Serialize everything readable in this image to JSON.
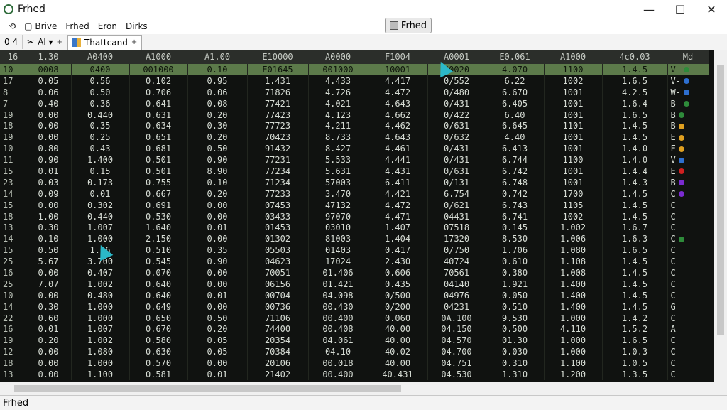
{
  "window": {
    "title": "Frhed",
    "minimize": "—",
    "maximize": "☐",
    "close": "✕"
  },
  "menu": {
    "items": [
      "Brive",
      "Frhed",
      "Eron",
      "Dirks"
    ]
  },
  "app_button": {
    "label": "Frhed"
  },
  "tabs": [
    {
      "label": "0 4"
    },
    {
      "label": "Al ▾",
      "close": "+"
    },
    {
      "label": "Thattcand",
      "close": "+"
    }
  ],
  "table": {
    "headers": [
      "16",
      "1.30",
      "A0400",
      "A1000",
      "A1.00",
      "E10000",
      "A0000",
      "F1004",
      "A0001",
      "E0.061",
      "A1000",
      "4c0.03",
      "Md"
    ],
    "rows": [
      [
        "10",
        "0008",
        "0400",
        "001000",
        "0.10",
        "E01645",
        "001000",
        "10001",
        "50020",
        "4.070",
        "1100",
        "1.4.5",
        "V-"
      ],
      [
        "17",
        "0.05",
        "0.56",
        "0.102",
        "0.95",
        "1.431",
        "4.433",
        "4.417",
        "0/552",
        "6.22",
        "1002",
        "1.6.5",
        "V-"
      ],
      [
        "8",
        "0.06",
        "0.50",
        "0.706",
        "0.06",
        "71826",
        "4.726",
        "4.472",
        "0/480",
        "6.670",
        "1001",
        "4.2.5",
        "W-"
      ],
      [
        "7",
        "0.40",
        "0.36",
        "0.641",
        "0.08",
        "77421",
        "4.021",
        "4.643",
        "0/431",
        "6.405",
        "1001",
        "1.6.4",
        "B-"
      ],
      [
        "19",
        "0.00",
        "0.440",
        "0.631",
        "0.20",
        "77423",
        "4.123",
        "4.662",
        "0/422",
        "6.40",
        "1001",
        "1.6.5",
        "B"
      ],
      [
        "18",
        "0.00",
        "0.35",
        "0.634",
        "0.30",
        "77723",
        "4.211",
        "4.462",
        "0/631",
        "6.645",
        "1101",
        "1.4.5",
        "B"
      ],
      [
        "19",
        "0.00",
        "0.25",
        "0.651",
        "0.20",
        "70423",
        "8.733",
        "4.643",
        "0/632",
        "4.40",
        "1001",
        "1.4.5",
        "E"
      ],
      [
        "10",
        "0.80",
        "0.43",
        "0.681",
        "0.50",
        "91432",
        "8.427",
        "4.461",
        "0/431",
        "6.413",
        "1001",
        "1.4.0",
        "F"
      ],
      [
        "11",
        "0.90",
        "1.400",
        "0.501",
        "0.90",
        "77231",
        "5.533",
        "4.441",
        "0/431",
        "6.744",
        "1100",
        "1.4.0",
        "V"
      ],
      [
        "15",
        "0.01",
        "0.15",
        "0.501",
        "8.90",
        "77234",
        "5.631",
        "4.431",
        "0/631",
        "6.742",
        "1001",
        "1.4.4",
        "E"
      ],
      [
        "23",
        "0.03",
        "0.173",
        "0.755",
        "0.10",
        "71234",
        "57003",
        "6.411",
        "0/131",
        "6.748",
        "1001",
        "1.4.3",
        "B"
      ],
      [
        "14",
        "0.09",
        "0.01",
        "0.667",
        "0.20",
        "77233",
        "3.470",
        "4.421",
        "6.754",
        "0.742",
        "1700",
        "1.4.5",
        "C"
      ],
      [
        "15",
        "0.00",
        "0.302",
        "0.691",
        "0.00",
        "07453",
        "47132",
        "4.472",
        "0/621",
        "6.743",
        "1105",
        "1.4.5",
        "C"
      ],
      [
        "18",
        "1.00",
        "0.440",
        "0.530",
        "0.00",
        "03433",
        "97070",
        "4.471",
        "04431",
        "6.741",
        "1002",
        "1.4.5",
        "C"
      ],
      [
        "13",
        "0.30",
        "1.007",
        "1.640",
        "0.01",
        "01453",
        "03010",
        "1.407",
        "07518",
        "0.145",
        "1.002",
        "1.6.7",
        "C"
      ],
      [
        "14",
        "0.10",
        "1.000",
        "2.150",
        "0.00",
        "01302",
        "81003",
        "1.404",
        "17320",
        "8.530",
        "1.006",
        "1.6.3",
        "C"
      ],
      [
        "15",
        "0.50",
        "1.06",
        "0.510",
        "0.35",
        "05503",
        "01403",
        "0.417",
        "0/750",
        "1.706",
        "1.080",
        "1.6.5",
        "C"
      ],
      [
        "25",
        "5.67",
        "3.700",
        "0.545",
        "0.90",
        "04623",
        "17024",
        "2.430",
        "40724",
        "0.610",
        "1.108",
        "1.4.5",
        "C"
      ],
      [
        "16",
        "0.00",
        "0.407",
        "0.070",
        "0.00",
        "70051",
        "01.406",
        "0.606",
        "70561",
        "0.380",
        "1.008",
        "1.4.5",
        "C"
      ],
      [
        "25",
        "7.07",
        "1.002",
        "0.640",
        "0.00",
        "06156",
        "01.421",
        "0.435",
        "04140",
        "1.921",
        "1.400",
        "1.4.5",
        "C"
      ],
      [
        "10",
        "0.00",
        "0.480",
        "0.640",
        "0.01",
        "00704",
        "04.098",
        "0/500",
        "04976",
        "0.050",
        "1.400",
        "1.4.5",
        "C"
      ],
      [
        "14",
        "0.30",
        "1.000",
        "0.649",
        "0.00",
        "00736",
        "00.430",
        "0/200",
        "04231",
        "0.510",
        "1.400",
        "1.4.5",
        "G"
      ],
      [
        "22",
        "0.60",
        "1.000",
        "0.650",
        "0.50",
        "71106",
        "00.400",
        "0.060",
        "0A.100",
        "9.530",
        "1.000",
        "1.4.2",
        "C"
      ],
      [
        "16",
        "0.01",
        "1.007",
        "0.670",
        "0.20",
        "74400",
        "00.408",
        "40.00",
        "04.150",
        "0.500",
        "4.110",
        "1.5.2",
        "A"
      ],
      [
        "19",
        "0.20",
        "1.002",
        "0.580",
        "0.05",
        "20354",
        "04.061",
        "40.00",
        "04.570",
        "01.30",
        "1.000",
        "1.6.5",
        "C"
      ],
      [
        "12",
        "0.00",
        "1.080",
        "0.630",
        "0.05",
        "70384",
        "04.10",
        "40.02",
        "04.700",
        "0.030",
        "1.000",
        "1.0.3",
        "C"
      ],
      [
        "18",
        "0.00",
        "1.000",
        "0.570",
        "0.00",
        "20106",
        "00.018",
        "40.00",
        "04.751",
        "0.310",
        "1.100",
        "1.0.5",
        "C"
      ],
      [
        "13",
        "0.00",
        "1.100",
        "0.581",
        "0.01",
        "21402",
        "00.400",
        "40.431",
        "04.530",
        "1.310",
        "1.200",
        "1.3.5",
        "C"
      ]
    ],
    "dot_colors": [
      "#2e8b3a",
      "#2e6fd0",
      "#2e6fd0",
      "#2e8b3a",
      "#2e8b3a",
      "#e0a020",
      "#e0a020",
      "#e0a020",
      "#2e6fd0",
      "#d02020",
      "#7a2bd0",
      "#7a2bd0",
      "",
      "",
      "",
      "#2e8b3a",
      "",
      "",
      "",
      "",
      "",
      "",
      "",
      "",
      "",
      "",
      "",
      ""
    ]
  },
  "status": {
    "label": "Frhed"
  },
  "colors": {
    "selected_row": "#5c7a4a",
    "cursor": "#2bb8c8"
  }
}
